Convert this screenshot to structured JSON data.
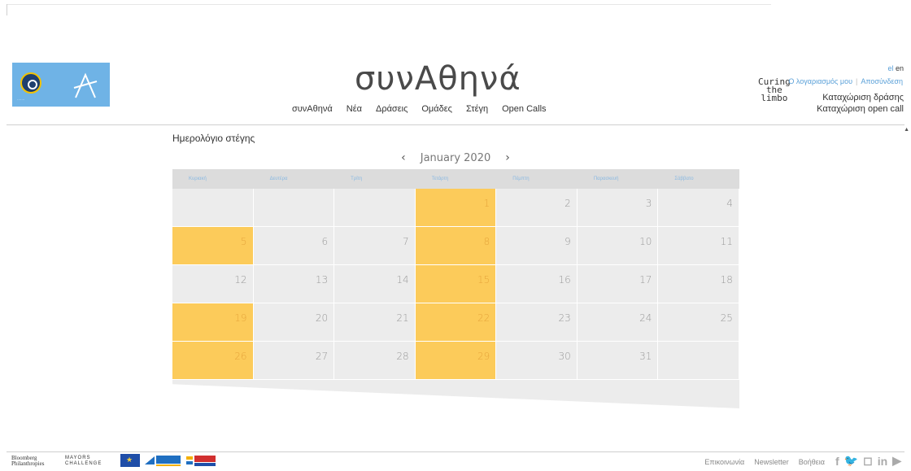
{
  "header": {
    "site_title": "συνΑθηνά",
    "nav": [
      "συνΑθηνά",
      "Νέα",
      "Δράσεις",
      "Ομάδες",
      "Στέγη",
      "Open Calls"
    ],
    "curing": [
      "Curing",
      "the",
      "limbo"
    ],
    "lang": {
      "el": "el",
      "en": "en"
    },
    "user_links": {
      "my_account": "Ο λογαριασμός μου",
      "logout": "Αποσύνδεση"
    },
    "submit_action": "Καταχώριση δράσης",
    "submit_open_call": "Καταχώριση open call"
  },
  "page": {
    "heading": "Ημερολόγιο στέγης"
  },
  "calendar": {
    "month_label": "January 2020",
    "prev": "‹",
    "next": "›",
    "weekdays": [
      "Κυριακή",
      "Δευτέρα",
      "Τρίτη",
      "Τετάρτη",
      "Πέμπτη",
      "Παρασκευή",
      "Σάββατο"
    ],
    "weeks": [
      [
        null,
        null,
        null,
        1,
        2,
        3,
        4
      ],
      [
        5,
        6,
        7,
        8,
        9,
        10,
        11
      ],
      [
        12,
        13,
        14,
        15,
        16,
        17,
        18
      ],
      [
        19,
        20,
        21,
        22,
        23,
        24,
        25
      ],
      [
        26,
        27,
        28,
        29,
        30,
        31,
        null
      ]
    ],
    "highlighted_days": [
      1,
      5,
      8,
      15,
      19,
      22,
      26,
      29
    ],
    "highlight_color": "#fccb5a"
  },
  "footer": {
    "bloomberg": [
      "Bloomberg",
      "Philanthropies"
    ],
    "mayors": [
      "MAYORS",
      "CHALLENGE"
    ],
    "links": [
      "Επικοινωνία",
      "Newsletter",
      "Βοήθεια"
    ],
    "social_icons": [
      "facebook-icon",
      "twitter-icon",
      "instagram-icon",
      "linkedin-icon",
      "youtube-icon"
    ]
  }
}
